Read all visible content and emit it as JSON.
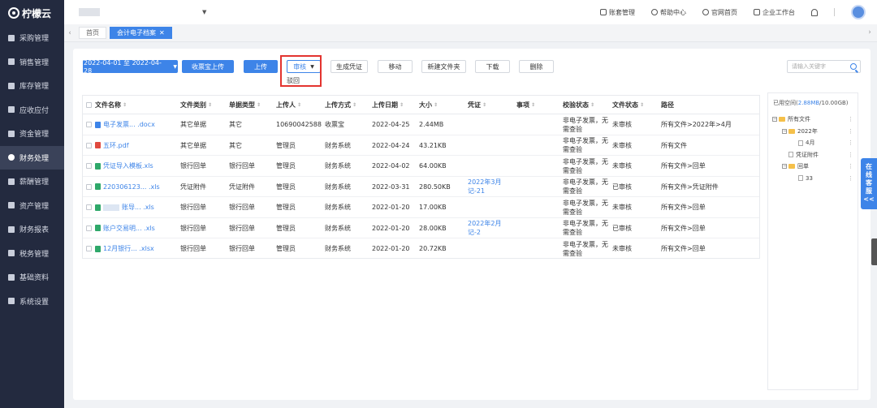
{
  "app": {
    "logo_text": "柠檬云"
  },
  "sidebar": {
    "items": [
      {
        "label": "采购管理",
        "icon": "cart-icon"
      },
      {
        "label": "销售管理",
        "icon": "diamond-icon"
      },
      {
        "label": "库存管理",
        "icon": "warehouse-icon"
      },
      {
        "label": "应收应付",
        "icon": "coin-icon"
      },
      {
        "label": "资金管理",
        "icon": "wallet-icon"
      },
      {
        "label": "财务处理",
        "icon": "ledger-icon",
        "active": true
      },
      {
        "label": "薪酬管理",
        "icon": "user-icon"
      },
      {
        "label": "资产管理",
        "icon": "asset-icon"
      },
      {
        "label": "财务报表",
        "icon": "report-icon"
      },
      {
        "label": "税务管理",
        "icon": "tax-icon"
      },
      {
        "label": "基础资料",
        "icon": "database-icon"
      },
      {
        "label": "系统设置",
        "icon": "gear-icon"
      }
    ]
  },
  "topbar": {
    "links": [
      {
        "label": "账套管理",
        "icon": "book-icon"
      },
      {
        "label": "帮助中心",
        "icon": "help-icon"
      },
      {
        "label": "官网首页",
        "icon": "home-icon"
      },
      {
        "label": "企业工作台",
        "icon": "monitor-icon"
      }
    ]
  },
  "tabs": [
    {
      "label": "首页",
      "active": false
    },
    {
      "label": "会计电子档案",
      "active": true,
      "close": "✕"
    }
  ],
  "toolbar": {
    "date_range": "2022-04-01 至 2022-04-28",
    "receipt_upload": "收票宝上传",
    "upload": "上传",
    "audit": "审核",
    "audit_dropdown_item": "驳回",
    "gen_voucher": "生成凭证",
    "move": "移动",
    "new_folder": "新建文件夹",
    "download": "下载",
    "delete": "删除",
    "search_placeholder": "请输入关键字"
  },
  "table": {
    "headers": [
      "文件名称",
      "文件类别",
      "单据类型",
      "上传人",
      "上传方式",
      "上传日期",
      "大小",
      "凭证",
      "事项",
      "校验状态",
      "文件状态",
      "路径"
    ],
    "rows": [
      {
        "icon": "docx",
        "name_prefix": "电子发票",
        "name": "电子发票...  .docx",
        "category": "其它单据",
        "doc_type": "其它",
        "uploader": "10690042588",
        "method": "收票宝",
        "date": "2022-04-25",
        "size": "2.44MB",
        "voucher": "",
        "matter": "",
        "check": "非电子发票，无需查验",
        "status": "未审核",
        "path": "所有文件>2022年>4月"
      },
      {
        "icon": "pdf",
        "name": "五环.pdf",
        "category": "其它单据",
        "doc_type": "其它",
        "uploader": "管理员",
        "method": "财务系统",
        "date": "2022-04-24",
        "size": "43.21KB",
        "voucher": "",
        "matter": "",
        "check": "非电子发票，无需查验",
        "status": "未审核",
        "path": "所有文件"
      },
      {
        "icon": "xls",
        "name": "凭证导入模板.xls",
        "category": "银行回单",
        "doc_type": "银行回单",
        "uploader": "管理员",
        "method": "财务系统",
        "date": "2022-04-02",
        "size": "64.00KB",
        "voucher": "",
        "matter": "",
        "check": "非电子发票，无需查验",
        "status": "未审核",
        "path": "所有文件>回单"
      },
      {
        "icon": "xls",
        "name": "220306123...  .xls",
        "category": "凭证附件",
        "doc_type": "凭证附件",
        "uploader": "管理员",
        "method": "财务系统",
        "date": "2022-03-31",
        "size": "280.50KB",
        "voucher": "2022年3月记-21",
        "matter": "",
        "check": "非电子发票，无需查验",
        "status": "已审核",
        "path": "所有文件>凭证附件"
      },
      {
        "icon": "xls",
        "name": "账导...  .xls",
        "redacted": true,
        "category": "银行回单",
        "doc_type": "银行回单",
        "uploader": "管理员",
        "method": "财务系统",
        "date": "2022-01-20",
        "size": "17.00KB",
        "voucher": "",
        "matter": "",
        "check": "非电子发票，无需查验",
        "status": "未审核",
        "path": "所有文件>回单"
      },
      {
        "icon": "xls",
        "name": "账户交易明...  .xls",
        "category": "银行回单",
        "doc_type": "银行回单",
        "uploader": "管理员",
        "method": "财务系统",
        "date": "2022-01-20",
        "size": "28.00KB",
        "voucher": "2022年2月记-2",
        "matter": "",
        "check": "非电子发票，无需查验",
        "status": "已审核",
        "path": "所有文件>回单"
      },
      {
        "icon": "xls",
        "name": "12月银行...  .xlsx",
        "category": "银行回单",
        "doc_type": "银行回单",
        "uploader": "管理员",
        "method": "财务系统",
        "date": "2022-01-20",
        "size": "20.72KB",
        "voucher": "",
        "matter": "",
        "check": "非电子发票，无需查验",
        "status": "未审核",
        "path": "所有文件>回单"
      }
    ]
  },
  "tree": {
    "usage_prefix": "已用空间(",
    "usage_value": "2.88MB",
    "usage_suffix": "/10.00GB)",
    "nodes": [
      {
        "label": "所有文件",
        "type": "folder",
        "level": 0,
        "toggle": "−"
      },
      {
        "label": "2022年",
        "type": "folder",
        "level": 1,
        "toggle": "−"
      },
      {
        "label": "4月",
        "type": "doc",
        "level": 2
      },
      {
        "label": "凭证附件",
        "type": "doc",
        "level": 1
      },
      {
        "label": "回单",
        "type": "folder",
        "level": 1,
        "toggle": "−"
      },
      {
        "label": "33",
        "type": "doc",
        "level": 2
      }
    ]
  },
  "service_tab": {
    "label": "在线客服",
    "arrow": "<<"
  }
}
